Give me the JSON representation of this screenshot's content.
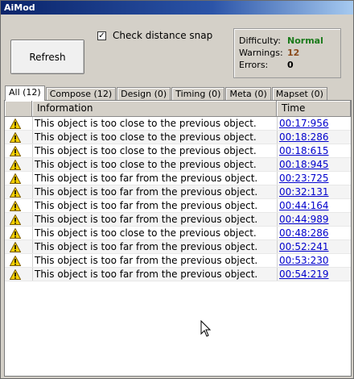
{
  "window": {
    "title": "AiMod"
  },
  "controls": {
    "refresh_label": "Refresh",
    "check_distance_label": "Check distance snap",
    "check_distance_checked": "✓"
  },
  "status": {
    "difficulty_label": "Difficulty:",
    "difficulty_value": "Normal",
    "warnings_label": "Warnings:",
    "warnings_value": "12",
    "errors_label": "Errors:",
    "errors_value": "0",
    "colors": {
      "difficulty": "#1a7a1a",
      "warnings": "#8a4a1a",
      "errors": "#000000"
    }
  },
  "tabs": [
    {
      "label": "All (12)"
    },
    {
      "label": "Compose (12)"
    },
    {
      "label": "Design (0)"
    },
    {
      "label": "Timing (0)"
    },
    {
      "label": "Meta (0)"
    },
    {
      "label": "Mapset (0)"
    }
  ],
  "table": {
    "headers": {
      "icon": "",
      "info": "Information",
      "time": "Time"
    },
    "rows": [
      {
        "icon": "warning-icon",
        "info": "This object is too close to the previous object.",
        "time": "00:17:956"
      },
      {
        "icon": "warning-icon",
        "info": "This object is too close to the previous object.",
        "time": "00:18:286"
      },
      {
        "icon": "warning-icon",
        "info": "This object is too close to the previous object.",
        "time": "00:18:615"
      },
      {
        "icon": "warning-icon",
        "info": "This object is too close to the previous object.",
        "time": "00:18:945"
      },
      {
        "icon": "warning-icon",
        "info": "This object is too far from the previous object.",
        "time": "00:23:725"
      },
      {
        "icon": "warning-icon",
        "info": "This object is too far from the previous object.",
        "time": "00:32:131"
      },
      {
        "icon": "warning-icon",
        "info": "This object is too far from the previous object.",
        "time": "00:44:164"
      },
      {
        "icon": "warning-icon",
        "info": "This object is too far from the previous object.",
        "time": "00:44:989"
      },
      {
        "icon": "warning-icon",
        "info": "This object is too close to the previous object.",
        "time": "00:48:286"
      },
      {
        "icon": "warning-icon",
        "info": "This object is too far from the previous object.",
        "time": "00:52:241"
      },
      {
        "icon": "warning-icon",
        "info": "This object is too far from the previous object.",
        "time": "00:53:230"
      },
      {
        "icon": "warning-icon",
        "info": "This object is too far from the previous object.",
        "time": "00:54:219"
      }
    ]
  }
}
